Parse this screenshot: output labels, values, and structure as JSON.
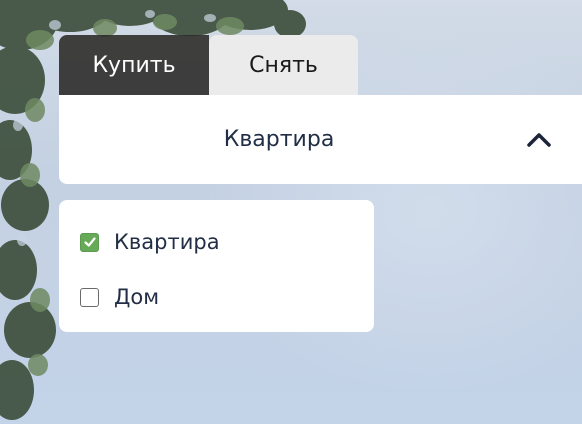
{
  "tabs": [
    {
      "label": "Купить",
      "active": true
    },
    {
      "label": "Снять",
      "active": false
    }
  ],
  "property_select": {
    "value": "Квартира",
    "icon": "chevron-up-icon",
    "expanded": true
  },
  "property_options": [
    {
      "label": "Квартира",
      "checked": true
    },
    {
      "label": "Дом",
      "checked": false
    }
  ],
  "colors": {
    "active_tab_bg": "#2a2826",
    "inactive_tab_bg": "#ebebeb",
    "text_dark": "#222e45",
    "checkbox_checked": "#66aa58"
  }
}
